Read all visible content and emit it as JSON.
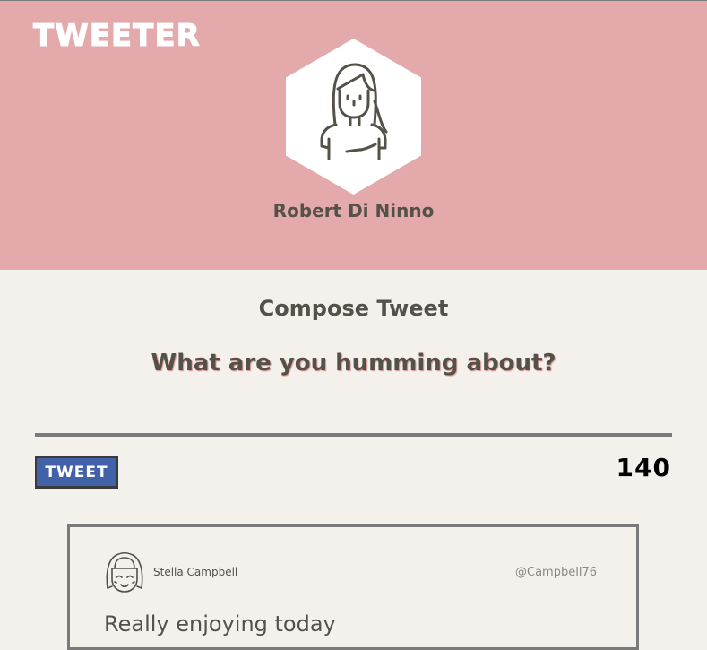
{
  "header": {
    "brand": "TWEETER",
    "profile_name": "Robert Di Ninno",
    "avatar_icon": "woman-avatar-icon",
    "background_color": "#e4aaab"
  },
  "compose": {
    "title": "Compose Tweet",
    "prompt": "What are you humming about?",
    "tweet_button_label": "TWEET",
    "char_count": "140",
    "button_color": "#4161a8"
  },
  "tweets": [
    {
      "avatar_icon": "girl-avatar-icon",
      "author": "Stella Campbell",
      "handle": "@Campbell76",
      "text": "Really enjoying today"
    }
  ]
}
